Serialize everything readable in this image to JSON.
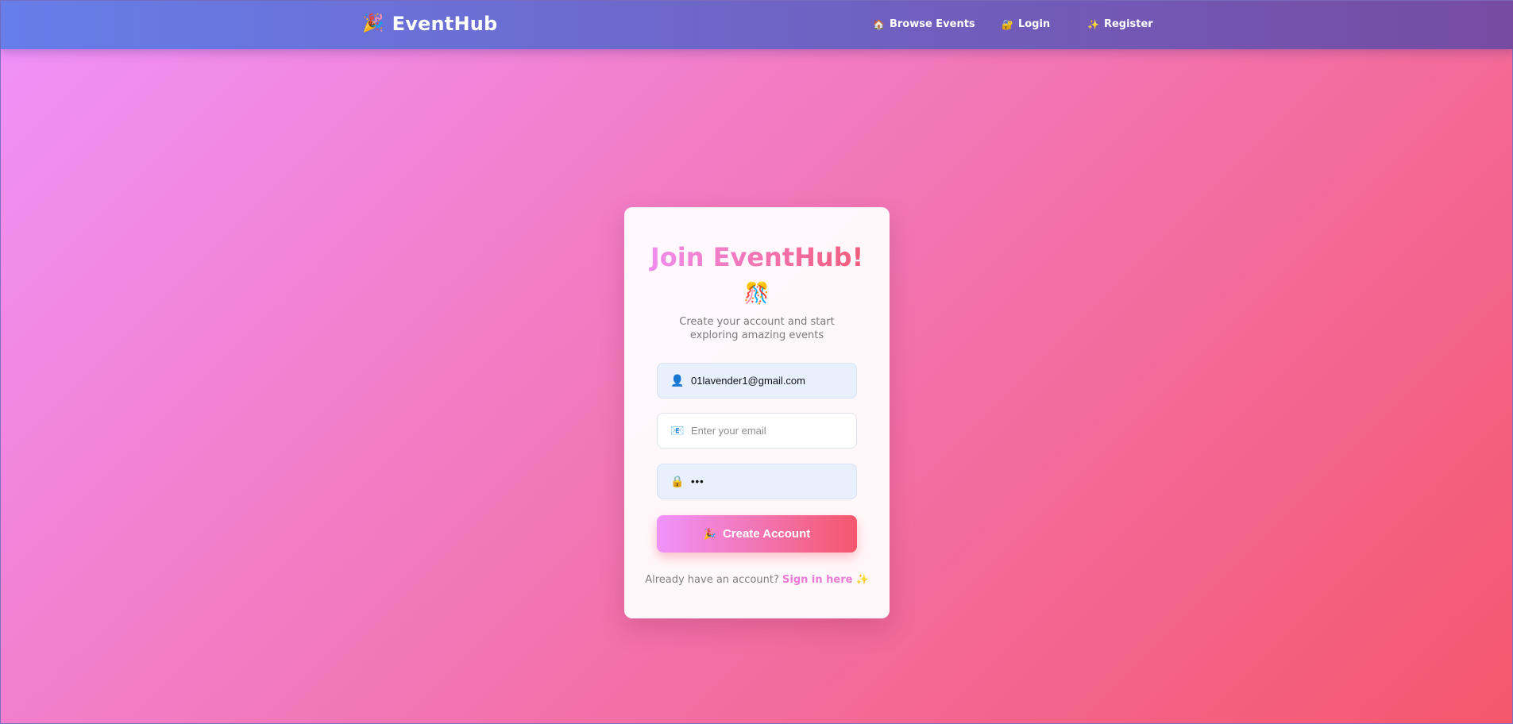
{
  "nav": {
    "brand": "EventHub",
    "brand_icon": "🎉",
    "links": [
      {
        "icon": "🏠",
        "label": "Browse Events"
      },
      {
        "icon": "🔐",
        "label": "Login"
      },
      {
        "icon": "✨",
        "label": "Register"
      }
    ]
  },
  "card": {
    "title": "Join EventHub!",
    "title_emoji": "🎊",
    "subtitle": "Create your account and start exploring amazing events",
    "username_icon": "👤",
    "username_value": "01lavender1@gmail.com",
    "email_icon": "📧",
    "email_placeholder": "Enter your email",
    "password_icon": "🔒",
    "password_value": "•••",
    "submit_icon": "🎉",
    "submit_label": "Create Account",
    "footer_text": "Already have an account?",
    "footer_link": "Sign in here",
    "footer_icon": "✨"
  },
  "colors": {
    "nav_gradient": [
      "#667eea",
      "#764ba2"
    ],
    "page_gradient": [
      "#f093fb",
      "#f5576c"
    ]
  }
}
